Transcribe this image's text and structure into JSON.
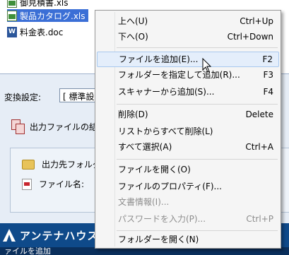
{
  "files": [
    {
      "name": "御見積書.xls",
      "icon": "excel-file-icon",
      "selected": false
    },
    {
      "name": "製品カタログ.xls",
      "icon": "excel-file-icon",
      "selected": true
    },
    {
      "name": "料金表.doc",
      "icon": "word-file-icon",
      "selected": false
    }
  ],
  "settings": {
    "conversion_label": "変換設定:",
    "conversion_value": "[ 標準設定",
    "merge_label": "出力ファイルの結合",
    "output_folder_label": "出力先フォルダー",
    "file_name_label": "ファイル名:"
  },
  "logo": {
    "text": "アンテナハウス"
  },
  "bottom_strip": {
    "text": "ァイルを追加"
  },
  "menu": {
    "items": [
      {
        "label": "上へ(U)",
        "shortcut": "Ctrl+Up"
      },
      {
        "label": "下へ(O)",
        "shortcut": "Ctrl+Down"
      },
      {
        "label": "ファイルを追加(E)...",
        "shortcut": "F2"
      },
      {
        "label": "フォルダーを指定して追加(R)...",
        "shortcut": "F3"
      },
      {
        "label": "スキャナーから追加(S)...",
        "shortcut": "F4"
      },
      {
        "label": "削除(D)",
        "shortcut": "Delete"
      },
      {
        "label": "リストからすべて削除(L)",
        "shortcut": ""
      },
      {
        "label": "すべて選択(A)",
        "shortcut": "Ctrl+A"
      },
      {
        "label": "ファイルを開く(O)",
        "shortcut": ""
      },
      {
        "label": "ファイルのプロパティ(F)...",
        "shortcut": ""
      },
      {
        "label": "文書情報(I)...",
        "shortcut": ""
      },
      {
        "label": "パスワードを入力(P)...",
        "shortcut": "Ctrl+P"
      },
      {
        "label": "フォルダーを開く(N)",
        "shortcut": ""
      }
    ]
  },
  "colors": {
    "selection": "#3b6fd6",
    "menu_hover": "#e4eefb",
    "disabled_text": "#8d8d8d",
    "logo_band": "#0f4a8a"
  }
}
